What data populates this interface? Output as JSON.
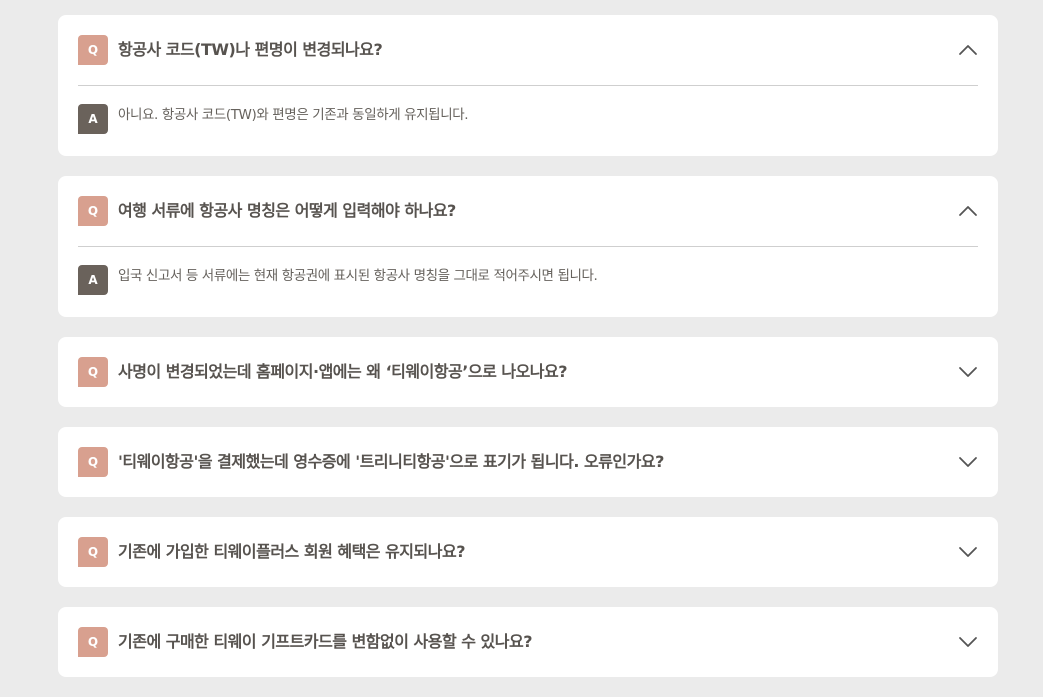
{
  "labels": {
    "question_badge": "Q",
    "answer_badge": "A"
  },
  "colors": {
    "page_background": "#ebebeb",
    "card_background": "#ffffff",
    "question_badge": "#d8a08f",
    "answer_badge": "#6a625b",
    "question_text": "#57534f",
    "answer_text": "#66625d"
  },
  "faq": [
    {
      "question": "항공사 코드(TW)나 편명이 변경되나요?",
      "answer": "아니요. 항공사 코드(TW)와 편명은 기존과 동일하게 유지됩니다.",
      "expanded": true,
      "toggle_icon": "chevron-up-icon"
    },
    {
      "question": "여행 서류에 항공사 명칭은 어떻게 입력해야 하나요?",
      "answer": "입국 신고서 등 서류에는 현재 항공권에 표시된 항공사 명칭을 그대로 적어주시면 됩니다.",
      "expanded": true,
      "toggle_icon": "chevron-up-icon"
    },
    {
      "question": "사명이 변경되었는데 홈페이지·앱에는 왜 ‘티웨이항공’으로 나오나요?",
      "expanded": false,
      "toggle_icon": "chevron-down-icon"
    },
    {
      "question": "'티웨이항공'을 결제했는데 영수증에 '트리니티항공'으로 표기가 됩니다. 오류인가요?",
      "expanded": false,
      "toggle_icon": "chevron-down-icon"
    },
    {
      "question": "기존에 가입한 티웨이플러스 회원 혜택은 유지되나요?",
      "expanded": false,
      "toggle_icon": "chevron-down-icon"
    },
    {
      "question": "기존에 구매한 티웨이 기프트카드를 변함없이 사용할 수 있나요?",
      "expanded": false,
      "toggle_icon": "chevron-down-icon"
    }
  ]
}
